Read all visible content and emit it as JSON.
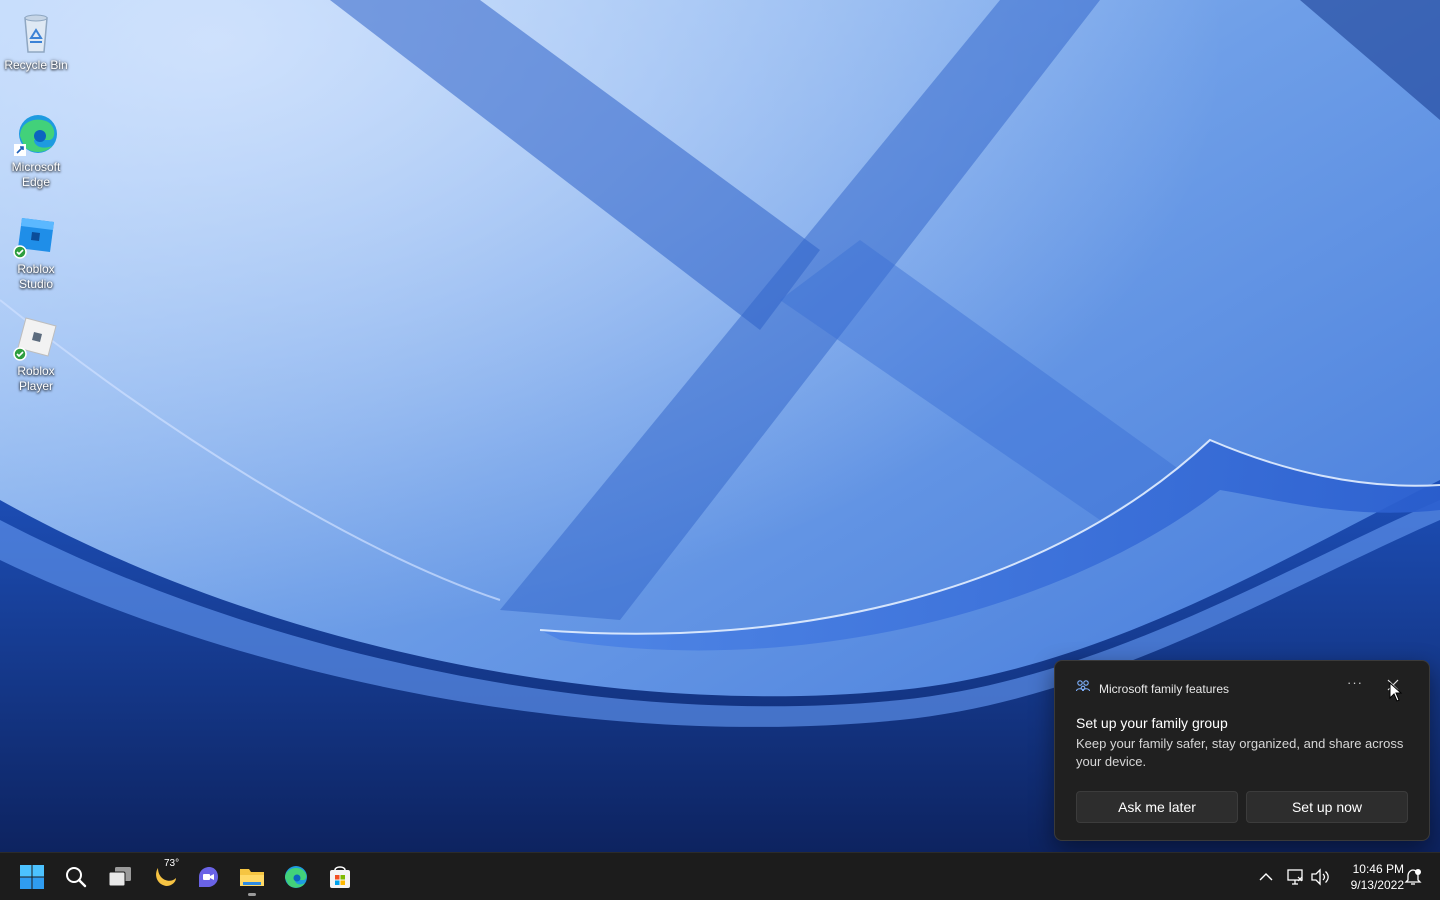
{
  "desktop": {
    "icons": [
      {
        "label": "Recycle Bin",
        "icon": "recycle-bin-icon"
      },
      {
        "label": "Microsoft Edge",
        "icon": "edge-icon"
      },
      {
        "label": "Roblox Studio",
        "icon": "roblox-studio-icon"
      },
      {
        "label": "Roblox Player",
        "icon": "roblox-player-icon"
      }
    ]
  },
  "toast": {
    "app_name": "Microsoft family features",
    "more_label": "···",
    "title": "Set up your family group",
    "body": "Keep your family safer, stay organized, and share across your device.",
    "btn_later": "Ask me later",
    "btn_setup": "Set up now"
  },
  "taskbar": {
    "weather_temp": "73°",
    "items": [
      "start-icon",
      "search-icon",
      "task-view-icon",
      "weather-icon",
      "chat-icon",
      "file-explorer-icon",
      "edge-icon",
      "store-icon"
    ],
    "tray": [
      "chevron-up-icon",
      "network-icon",
      "volume-icon",
      "notification-icon"
    ],
    "time": "10:46 PM",
    "date": "9/13/2022"
  },
  "colors": {
    "accent": "#3b7ae8",
    "wallpaper_light": "#7fb0f5",
    "wallpaper_dark": "#0f2a6b",
    "toast_bg": "#202020",
    "taskbar_bg": "#1c1c1c"
  }
}
